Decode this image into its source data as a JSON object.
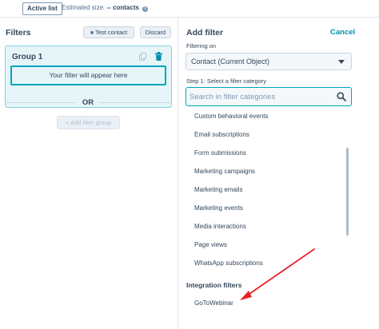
{
  "topbar": {
    "list_type": "Active list",
    "estimate_label": "Estimated size:",
    "estimate_value": "-- contacts"
  },
  "left_panel": {
    "title": "Filters",
    "test_contact_label": "Test contact",
    "discard_label": "Discard",
    "group": {
      "title": "Group 1",
      "placeholder": "Your filter will appear here"
    },
    "or_label": "OR",
    "add_group_label": "+ Add filter group"
  },
  "right_panel": {
    "title": "Add filter",
    "cancel_label": "Cancel",
    "filtering_on_label": "Filtering on",
    "filtering_on_value": "Contact (Current Object)",
    "step_label": "Step 1: Select a filter category",
    "search_placeholder": "Search in filter categories",
    "categories": [
      "Custom behavioral events",
      "Email subscriptions",
      "Form submissions",
      "Marketing campaigns",
      "Marketing emails",
      "Marketing events",
      "Media interactions",
      "Page views",
      "WhatsApp subscriptions"
    ],
    "integration_header": "Integration filters",
    "integration_items": [
      "GoToWebinar"
    ]
  },
  "colors": {
    "accent": "#00a4bd",
    "link": "#0091ae",
    "annotation_arrow": "#e8232a",
    "text": "#33475b"
  },
  "icons": [
    "info-icon",
    "person-icon",
    "copy-icon",
    "trash-icon",
    "dropdown-caret-icon",
    "search-icon",
    "red-arrow-annotation"
  ]
}
